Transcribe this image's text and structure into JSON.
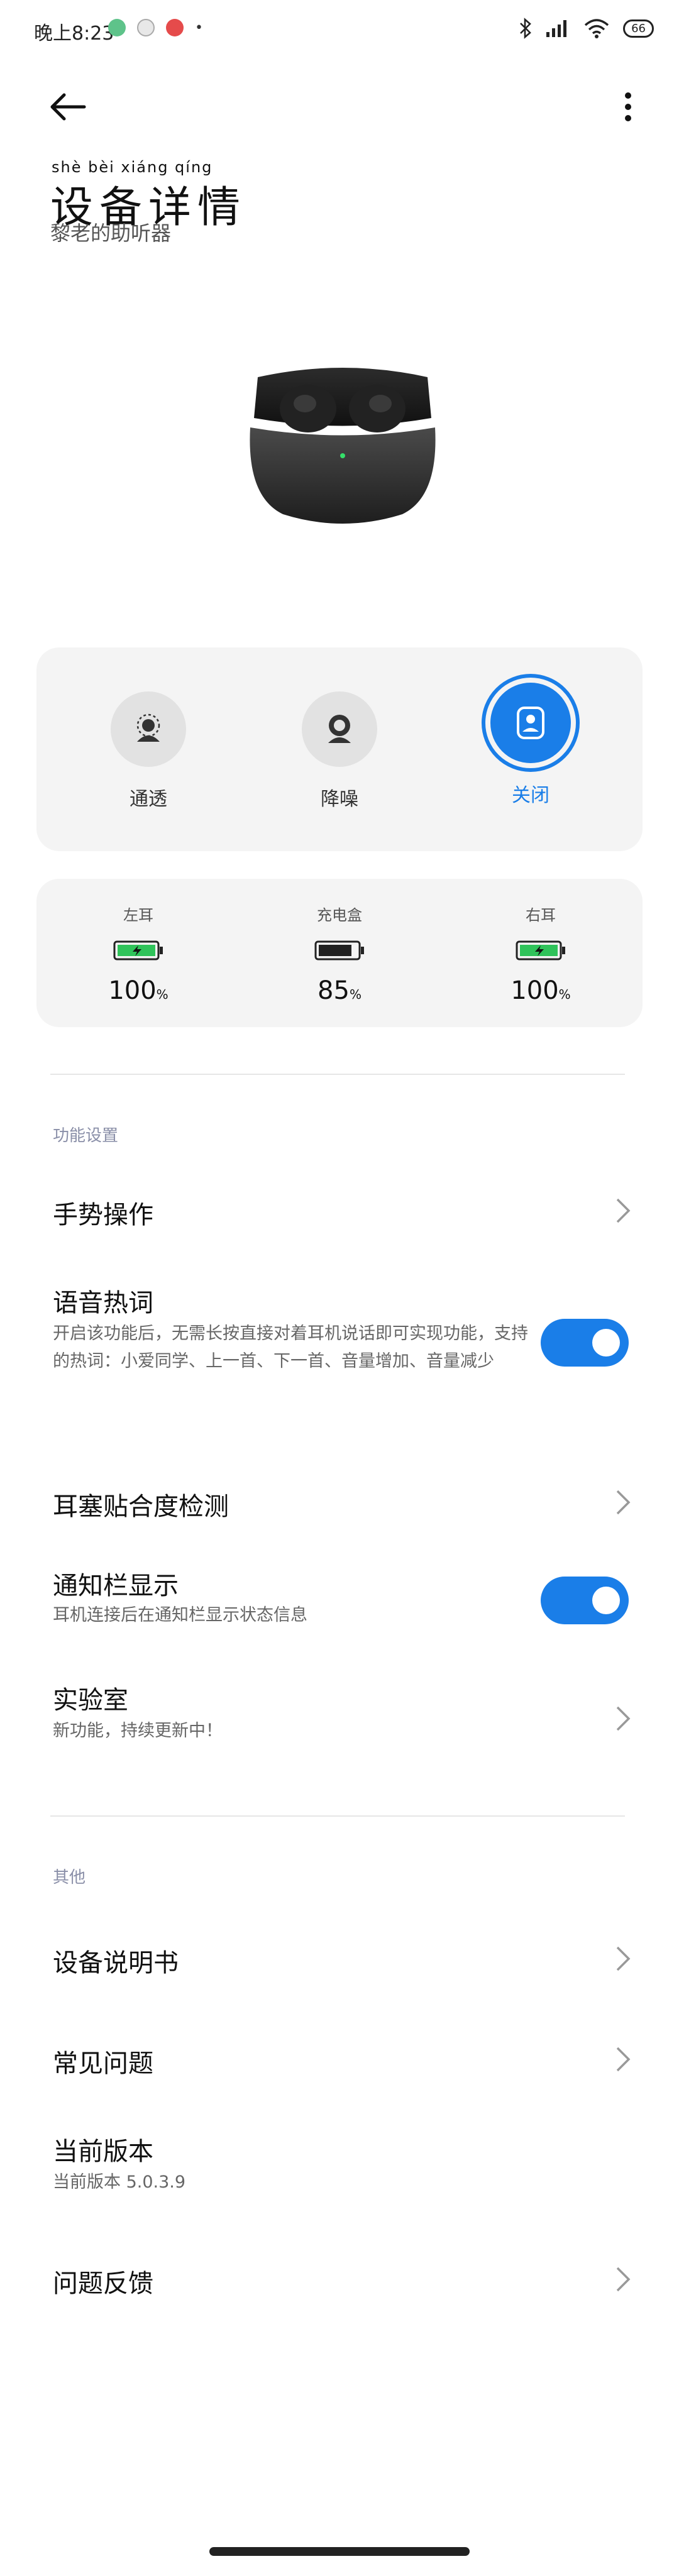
{
  "status_bar": {
    "time": "晚上8:23",
    "extra_dot": "•",
    "battery": "66"
  },
  "header": {
    "title_ruby": "shè  bèi  xiáng  qíng",
    "title": "设备详情",
    "subtitle": "黎老的助听器"
  },
  "modes": [
    {
      "label": "通透",
      "active": false
    },
    {
      "label": "降噪",
      "active": false
    },
    {
      "label": "关闭",
      "active": true
    }
  ],
  "battery": [
    {
      "label": "左耳",
      "value": "100",
      "unit": "%",
      "color": "#2fc35a"
    },
    {
      "label": "充电盒",
      "value": "85",
      "unit": "%",
      "color": "#222222"
    },
    {
      "label": "右耳",
      "value": "100",
      "unit": "%",
      "color": "#2fc35a"
    }
  ],
  "sections": {
    "function_settings": "功能设置",
    "other": "其他"
  },
  "settings": {
    "gesture": {
      "title": "手势操作"
    },
    "voice_hotword": {
      "title": "语音热词",
      "desc": "开启该功能后，无需长按直接对着耳机说话即可实现功能，支持的热词：小爱同学、上一首、下一首、音量增加、音量减少",
      "enabled": true
    },
    "fit_test": {
      "title": "耳塞贴合度检测"
    },
    "notification": {
      "title": "通知栏显示",
      "desc": "耳机连接后在通知栏显示状态信息",
      "enabled": true
    },
    "lab": {
      "title": "实验室",
      "desc": "新功能，持续更新中！"
    }
  },
  "other": {
    "manual": {
      "title": "设备说明书"
    },
    "faq": {
      "title": "常见问题"
    },
    "version": {
      "title": "当前版本",
      "desc": "当前版本 5.0.3.9"
    },
    "feedback": {
      "title": "问题反馈"
    }
  },
  "colors": {
    "accent": "#1a7ee8",
    "card_bg": "#f4f4f4",
    "battery_green": "#2fc35a"
  }
}
